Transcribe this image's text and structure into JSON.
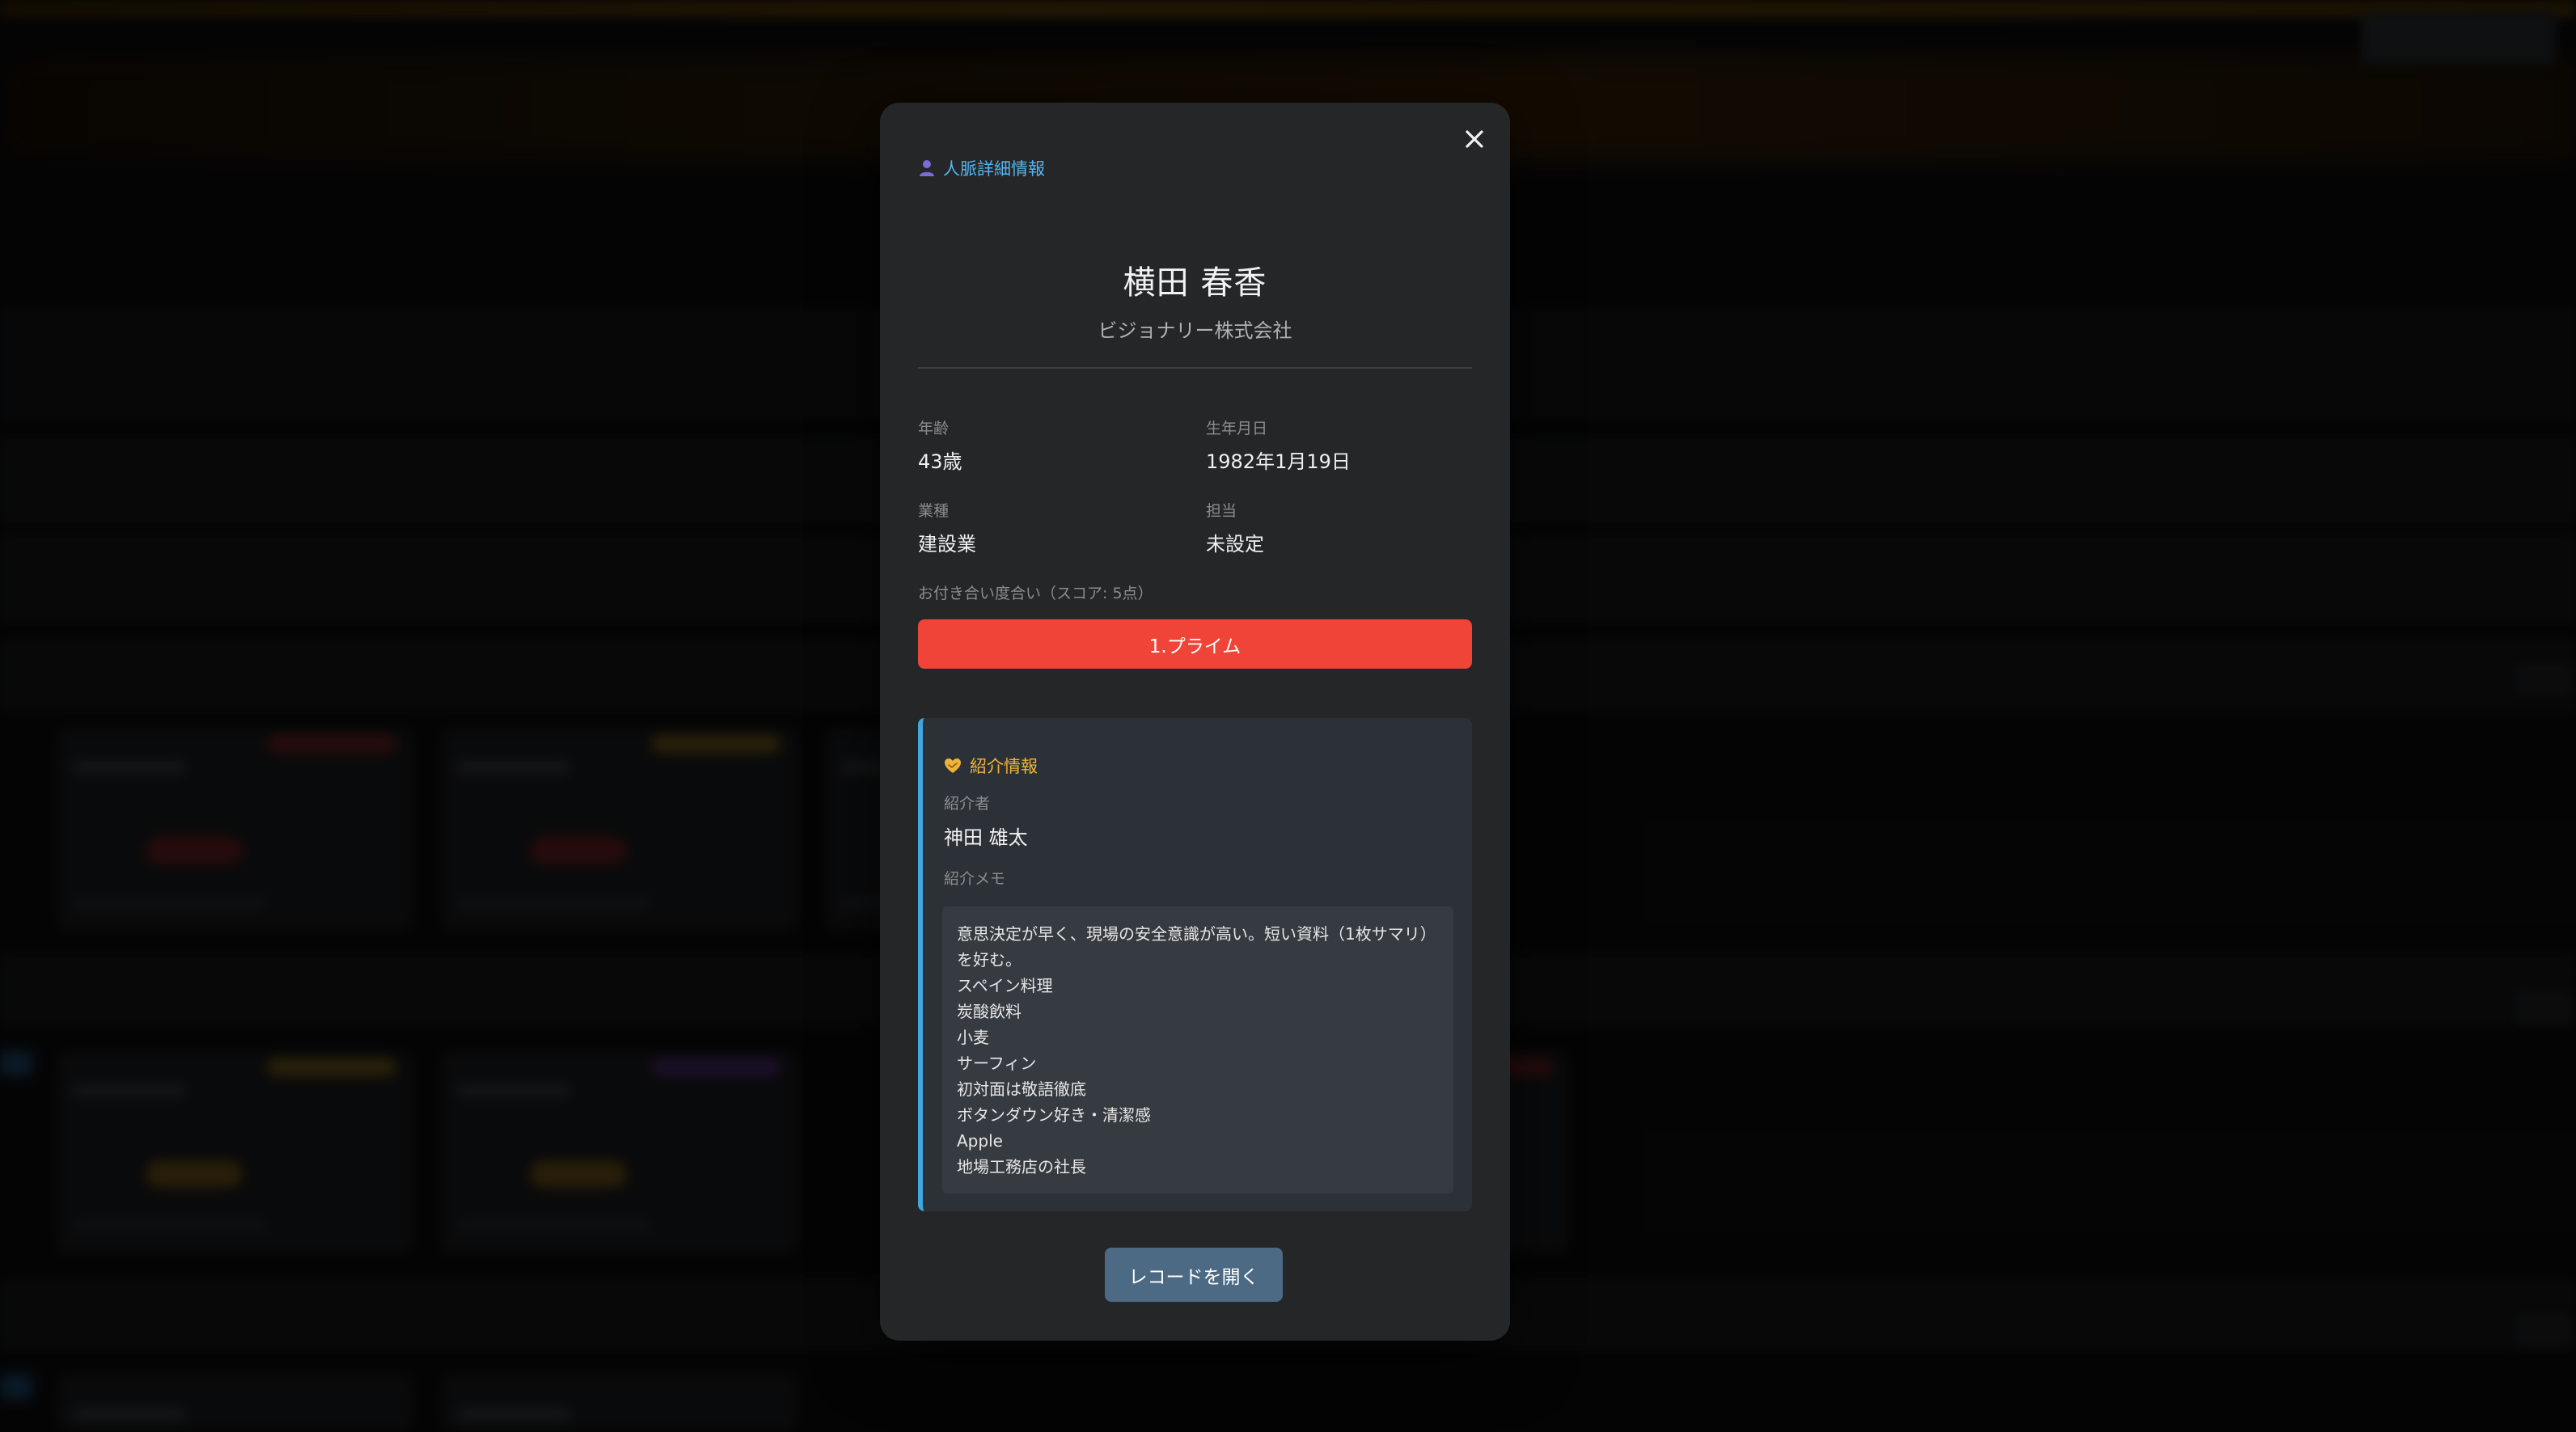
{
  "modal": {
    "heading": "人脈詳細情報",
    "close_icon": "close-icon",
    "person": {
      "name": "横田 春香",
      "company": "ビジョナリー株式会社"
    },
    "fields": {
      "age_label": "年齢",
      "age_value": "43歳",
      "birthdate_label": "生年月日",
      "birthdate_value": "1982年1月19日",
      "industry_label": "業種",
      "industry_value": "建設業",
      "owner_label": "担当",
      "owner_value": "未設定"
    },
    "relationship": {
      "label": "お付き合い度合い（スコア: 5点）",
      "value": "1.プライム",
      "color": "#f04438"
    },
    "referral": {
      "title": "紹介情報",
      "title_icon": "heart-handshake-icon",
      "referrer_label": "紹介者",
      "referrer_value": "神田 雄太",
      "memo_label": "紹介メモ",
      "memo_lines": [
        "意思決定が早く、現場の安全意識が高い。短い資料（1枚サマリ）",
        "を好む。",
        "スペイン料理",
        "炭酸飲料",
        "小麦",
        "サーフィン",
        "初対面は敬語徹底",
        "ボタンダウン好き・清潔感",
        "Apple",
        "地場工務店の社長"
      ]
    },
    "open_record_button": "レコードを開く"
  },
  "colors": {
    "accent_blue": "#55b6f0",
    "accent_gold": "#f0b33a",
    "modal_bg": "#242628",
    "button_bg": "#4c6a84"
  }
}
